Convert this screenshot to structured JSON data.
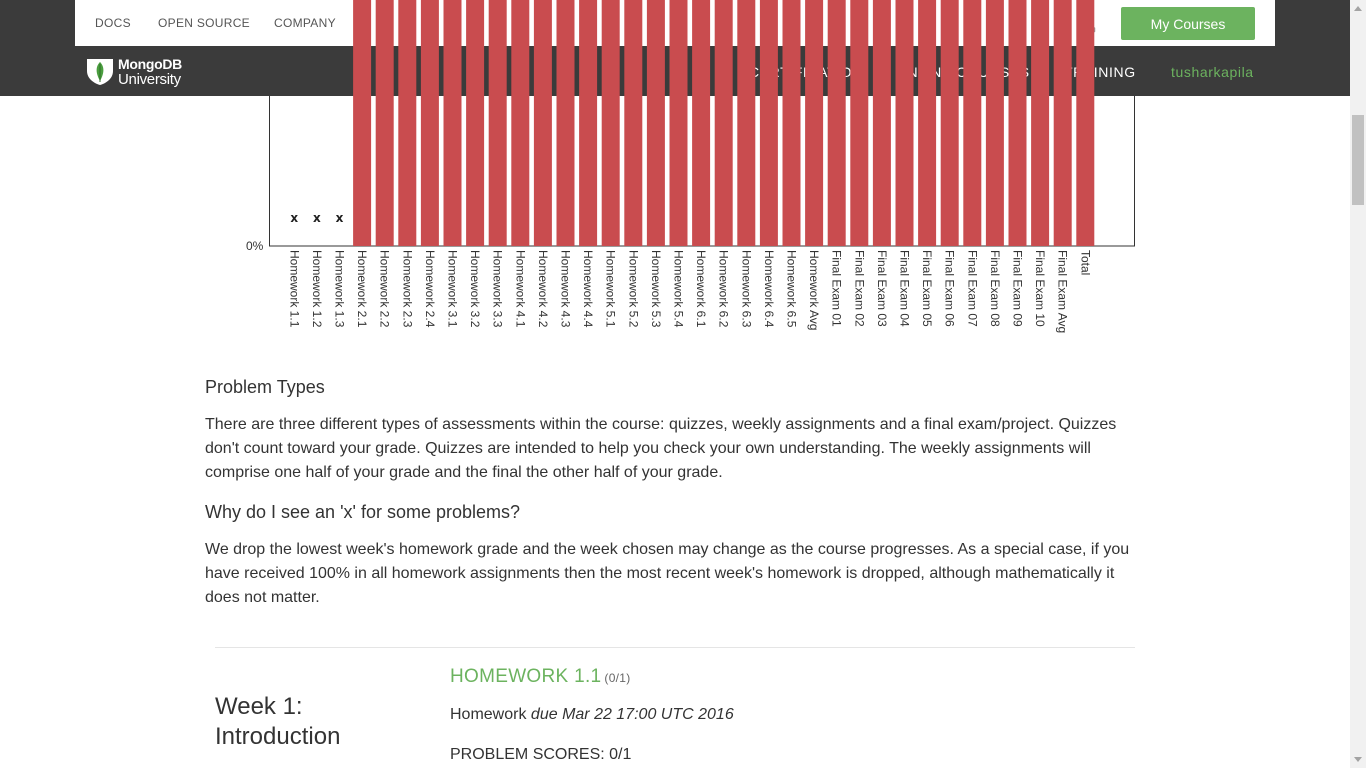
{
  "topbar": {
    "links": [
      "DOCS",
      "OPEN SOURCE",
      "COMPANY"
    ],
    "phone_icon": "phone-icon",
    "my_courses_label": "My Courses"
  },
  "navbar": {
    "brand_line1": "MongoDB",
    "brand_line2": "University",
    "links": [
      "CERTIFICATION",
      "ONLINE COURSES",
      "TRAINING"
    ],
    "username": "tusharkapila"
  },
  "colors": {
    "accent_green": "#6cb35f",
    "bar_red": "#c94c4f",
    "navbar_bg": "#3b3b3b"
  },
  "chart_data": {
    "type": "bar",
    "y_tick_label": "0%",
    "categories": [
      "Homework 1.1",
      "Homework 1.2",
      "Homework 1.3",
      "Homework 2.1",
      "Homework 2.2",
      "Homework 2.3",
      "Homework 2.4",
      "Homework 3.1",
      "Homework 3.2",
      "Homework 3.3",
      "Homework 4.1",
      "Homework 4.2",
      "Homework 4.3",
      "Homework 4.4",
      "Homework 5.1",
      "Homework 5.2",
      "Homework 5.3",
      "Homework 5.4",
      "Homework 6.1",
      "Homework 6.2",
      "Homework 6.3",
      "Homework 6.4",
      "Homework 6.5",
      "Homework Avg",
      "Final Exam 01",
      "Final Exam 02",
      "Final Exam 03",
      "Final Exam 04",
      "Final Exam 05",
      "Final Exam 06",
      "Final Exam 07",
      "Final Exam 08",
      "Final Exam 09",
      "Final Exam 10",
      "Final Exam Avg",
      "Total"
    ],
    "dropped_marker": "x",
    "dropped": [
      true,
      true,
      true,
      false,
      false,
      false,
      false,
      false,
      false,
      false,
      false,
      false,
      false,
      false,
      false,
      false,
      false,
      false,
      false,
      false,
      false,
      false,
      false,
      false,
      false,
      false,
      false,
      false,
      false,
      false,
      false,
      false,
      false,
      false,
      false,
      false
    ],
    "bar_filled": [
      false,
      false,
      false,
      true,
      true,
      true,
      true,
      true,
      true,
      true,
      true,
      true,
      true,
      true,
      true,
      true,
      true,
      true,
      true,
      true,
      true,
      true,
      true,
      true,
      true,
      true,
      true,
      true,
      true,
      true,
      true,
      true,
      true,
      true,
      true,
      true
    ]
  },
  "content": {
    "problem_types_heading": "Problem Types",
    "problem_types_text": "There are three different types of assessments within the course: quizzes, weekly assignments and a final exam/project. Quizzes don't count toward your grade. Quizzes are intended to help you check your own understanding. The weekly assignments will comprise one half of your grade and the final the other half of your grade.",
    "why_x_heading": "Why do I see an 'x' for some problems?",
    "why_x_text": "We drop the lowest week's homework grade and the week chosen may change as the course progresses. As a special case, if you have received 100% in all homework assignments then the most recent week's homework is dropped, although mathematically it does not matter."
  },
  "week": {
    "title_line1": "Week 1:",
    "title_line2": "Introduction",
    "homework_title": "HOMEWORK 1.1",
    "homework_score": "(0/1)",
    "homework_label": "Homework",
    "due_text": "due Mar 22 17:00 UTC 2016",
    "problem_scores": "PROBLEM SCORES: 0/1"
  }
}
